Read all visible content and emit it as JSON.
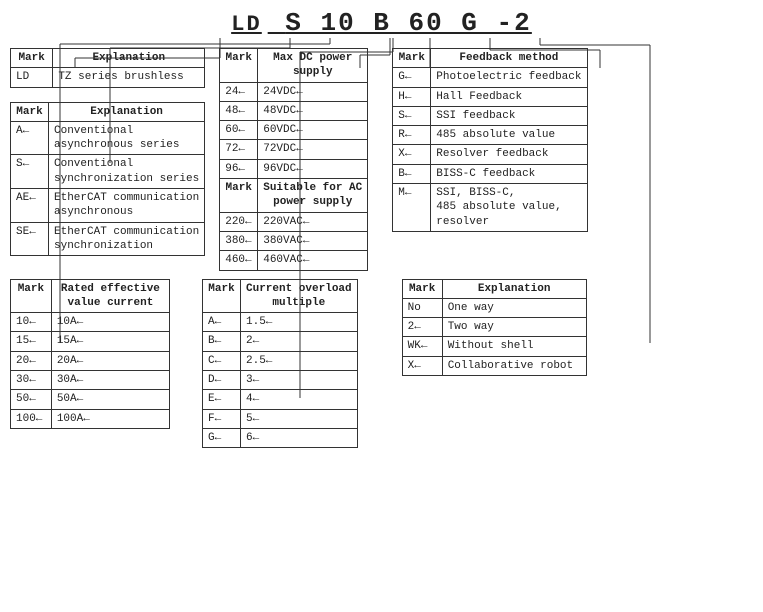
{
  "title": {
    "prefix": "LD",
    "main": "S 10 B 60 G -2"
  },
  "table_ld": {
    "headers": [
      "Mark",
      "Explanation"
    ],
    "rows": [
      [
        "LD",
        "TZ series brushless"
      ]
    ]
  },
  "table_series": {
    "headers": [
      "Mark",
      "Explanation"
    ],
    "rows": [
      [
        "A←",
        "Conventional\nasynchronous series"
      ],
      [
        "S←",
        "Conventional\nsynchronization series"
      ],
      [
        "AE←",
        "EtherCAT communication\nasynchronous"
      ],
      [
        "SE←",
        "EtherCAT communication\nsynchronization"
      ]
    ]
  },
  "table_rated_current": {
    "headers": [
      "Mark",
      "Rated effective\nvalue current"
    ],
    "rows": [
      [
        "10←",
        "10A←"
      ],
      [
        "15←",
        "15A←"
      ],
      [
        "20←",
        "20A←"
      ],
      [
        "30←",
        "30A←"
      ],
      [
        "50←",
        "50A←"
      ],
      [
        "100←",
        "100A←"
      ]
    ]
  },
  "table_dc_power": {
    "headers_row1": [
      "Mark",
      "Max DC power\nsupply"
    ],
    "rows_dc": [
      [
        "24←",
        "24VDC←"
      ],
      [
        "48←",
        "48VDC←"
      ],
      [
        "60←",
        "60VDC←"
      ],
      [
        "72←",
        "72VDC←"
      ],
      [
        "96←",
        "96VDC←"
      ]
    ],
    "headers_row2": [
      "Mark",
      "Suitable for AC\npower supply"
    ],
    "rows_ac": [
      [
        "220←",
        "220VAC←"
      ],
      [
        "380←",
        "380VAC←"
      ],
      [
        "460←",
        "460VAC←"
      ]
    ]
  },
  "table_current_overload": {
    "headers": [
      "Mark",
      "Current overload\nmultiple"
    ],
    "rows": [
      [
        "A←",
        "1.5←"
      ],
      [
        "B←",
        "2←"
      ],
      [
        "C←",
        "2.5←"
      ],
      [
        "D←",
        "3←"
      ],
      [
        "E←",
        "4←"
      ],
      [
        "F←",
        "5←"
      ],
      [
        "G←",
        "6←"
      ]
    ]
  },
  "table_feedback": {
    "headers": [
      "Mark",
      "Feedback method"
    ],
    "rows": [
      [
        "G←",
        "Photoelectric feedback"
      ],
      [
        "H←",
        "Hall Feedback"
      ],
      [
        "S←",
        "SSI feedback"
      ],
      [
        "R←",
        "485 absolute value"
      ],
      [
        "X←",
        "Resolver feedback"
      ],
      [
        "B←",
        "BISS-C feedback"
      ],
      [
        "M←",
        "SSI, BISS-C,\n485 absolute value,\nresolver"
      ]
    ]
  },
  "table_explanation2": {
    "headers": [
      "Mark",
      "Explanation"
    ],
    "rows": [
      [
        "No",
        "One way"
      ],
      [
        "2←",
        "Two way"
      ],
      [
        "WK←",
        "Without shell"
      ],
      [
        "X←",
        "Collaborative robot"
      ]
    ]
  }
}
